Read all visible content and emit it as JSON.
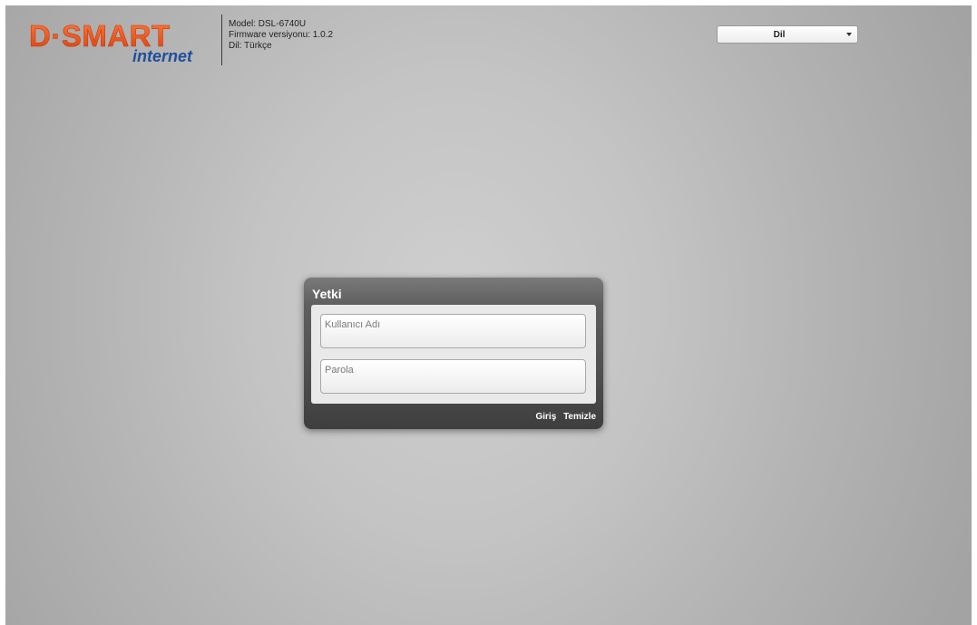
{
  "brand": {
    "logo_main": "D·SMART",
    "logo_sub": "internet",
    "logo_color": "#e8541c",
    "logo_sub_color": "#1f4f9c"
  },
  "device": {
    "model": "Model: DSL-6740U",
    "firmware": "Firmware versiyonu:  1.0.2",
    "language": "Dil: Türkçe"
  },
  "language_select": {
    "value": "Dil"
  },
  "login": {
    "title": "Yetki",
    "username_placeholder": "Kullanıcı Adı",
    "password_placeholder": "Parola",
    "login_label": "Giriş",
    "clear_label": "Temizle"
  }
}
